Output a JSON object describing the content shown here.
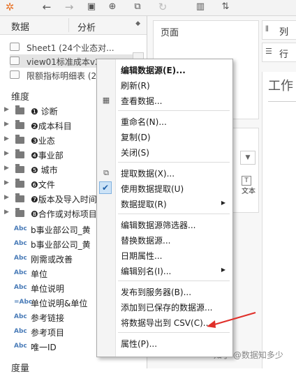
{
  "toolbar": {
    "icons": [
      "tableau-logo-icon",
      "undo-icon",
      "redo-icon",
      "save-icon",
      "new-datasource-icon",
      "duplicate-sheet-icon",
      "refresh-icon",
      "chart-type-icon",
      "sort-icon"
    ]
  },
  "left_pane": {
    "title": "数据",
    "analysis_tab": "分析",
    "datasources": [
      {
        "label": "Sheet1 (24个业态对..."
      },
      {
        "label": "view01标准成本v2"
      },
      {
        "label": "限额指标明细表 (2"
      }
    ],
    "dimensions_header": "维度",
    "folders": [
      {
        "label": "❶ 诊断"
      },
      {
        "label": "❷成本科目"
      },
      {
        "label": "❸业态"
      },
      {
        "label": "❹事业部"
      },
      {
        "label": "❺ 城市"
      },
      {
        "label": "❻文件"
      },
      {
        "label": "❼版本及导入时间"
      },
      {
        "label": "❽合作或对标项目"
      }
    ],
    "fields": [
      {
        "type": "Abc",
        "label": "b事业部公司_黄"
      },
      {
        "type": "Abc",
        "label": "b事业部公司_黄"
      },
      {
        "type": "Abc",
        "label": "刚需或改善"
      },
      {
        "type": "Abc",
        "label": "单位"
      },
      {
        "type": "Abc",
        "label": "单位说明"
      },
      {
        "type": "=Abc",
        "label": "单位说明&单位"
      },
      {
        "type": "Abc",
        "label": "参考链接"
      },
      {
        "type": "Abc",
        "label": "参考项目"
      },
      {
        "type": "Abc",
        "label": "唯一ID"
      }
    ],
    "measures_header": "度量"
  },
  "right_pane": {
    "pages_title": "页面",
    "columns_label": "列",
    "rows_label": "行",
    "sheet_title": "工作",
    "marks_text_label": "文本",
    "marks_text_icon": "T"
  },
  "context_menu": {
    "groups": [
      [
        {
          "label": "编辑数据源(E)...",
          "bold": true
        },
        {
          "label": "刷新(R)"
        },
        {
          "label": "查看数据...",
          "icon": "table-icon"
        }
      ],
      [
        {
          "label": "重命名(N)..."
        },
        {
          "label": "复制(D)"
        },
        {
          "label": "关闭(S)"
        }
      ],
      [
        {
          "label": "提取数据(X)...",
          "icon": "extract-icon"
        },
        {
          "label": "使用数据提取(U)",
          "checked": true
        },
        {
          "label": "数据提取(R)",
          "submenu": true
        }
      ],
      [
        {
          "label": "编辑数据源筛选器..."
        },
        {
          "label": "替换数据源..."
        },
        {
          "label": "日期属性..."
        },
        {
          "label": "编辑别名(I)...",
          "submenu": true
        }
      ],
      [
        {
          "label": "发布到服务器(B)..."
        },
        {
          "label": "添加到已保存的数据源..."
        },
        {
          "label": "将数据导出到 CSV(C)..."
        }
      ],
      [
        {
          "label": "属性(P)..."
        }
      ]
    ]
  },
  "watermark": "知乎 @数据知多少",
  "colors": {
    "annotation_arrow": "#e0302a",
    "check_bg": "#cde3f7"
  }
}
